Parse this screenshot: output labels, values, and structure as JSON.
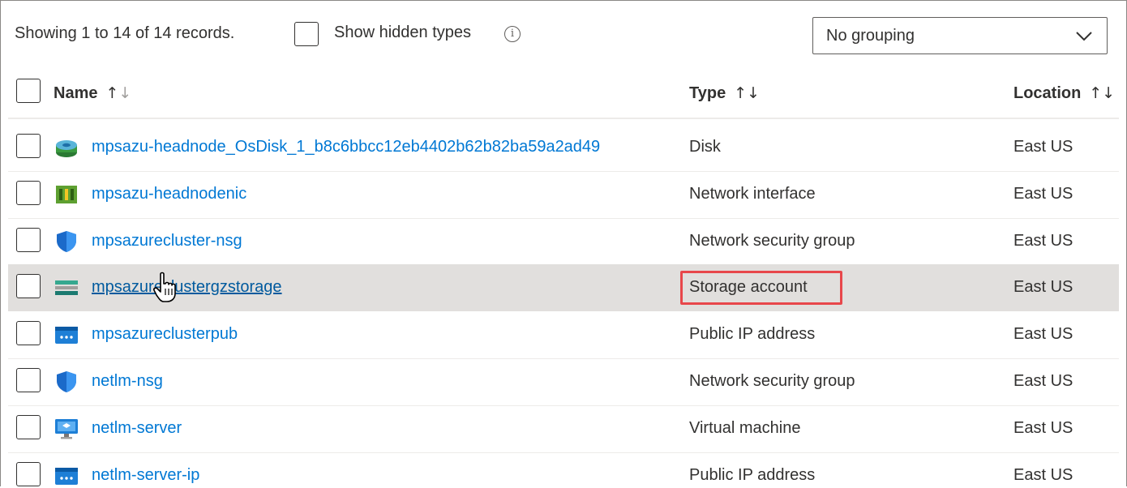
{
  "toolbar": {
    "record_count": "Showing 1 to 14 of 14 records.",
    "show_hidden_label": "Show hidden types",
    "info_glyph": "i",
    "grouping_value": "No grouping"
  },
  "columns": {
    "name": "Name",
    "type": "Type",
    "location": "Location"
  },
  "rows": [
    {
      "name": "mpsazu-headnode_OsDisk_1_b8c6bbcc12eb4402b62b82ba59a2ad49",
      "type": "Disk",
      "location": "East US",
      "icon": "disk-icon"
    },
    {
      "name": "mpsazu-headnodenic",
      "type": "Network interface",
      "location": "East US",
      "icon": "network-interface-icon"
    },
    {
      "name": "mpsazurecluster-nsg",
      "type": "Network security group",
      "location": "East US",
      "icon": "shield-icon"
    },
    {
      "name": "mpsazureclustergzstorage",
      "type": "Storage account",
      "location": "East US",
      "icon": "storage-account-icon"
    },
    {
      "name": "mpsazureclusterpub",
      "type": "Public IP address",
      "location": "East US",
      "icon": "public-ip-icon"
    },
    {
      "name": "netlm-nsg",
      "type": "Network security group",
      "location": "East US",
      "icon": "shield-icon"
    },
    {
      "name": "netlm-server",
      "type": "Virtual machine",
      "location": "East US",
      "icon": "virtual-machine-icon"
    },
    {
      "name": "netlm-server-ip",
      "type": "Public IP address",
      "location": "East US",
      "icon": "public-ip-icon"
    }
  ],
  "colors": {
    "link": "#0078d4",
    "hover_row": "#e1dfdd",
    "highlight_border": "#e8474b"
  }
}
